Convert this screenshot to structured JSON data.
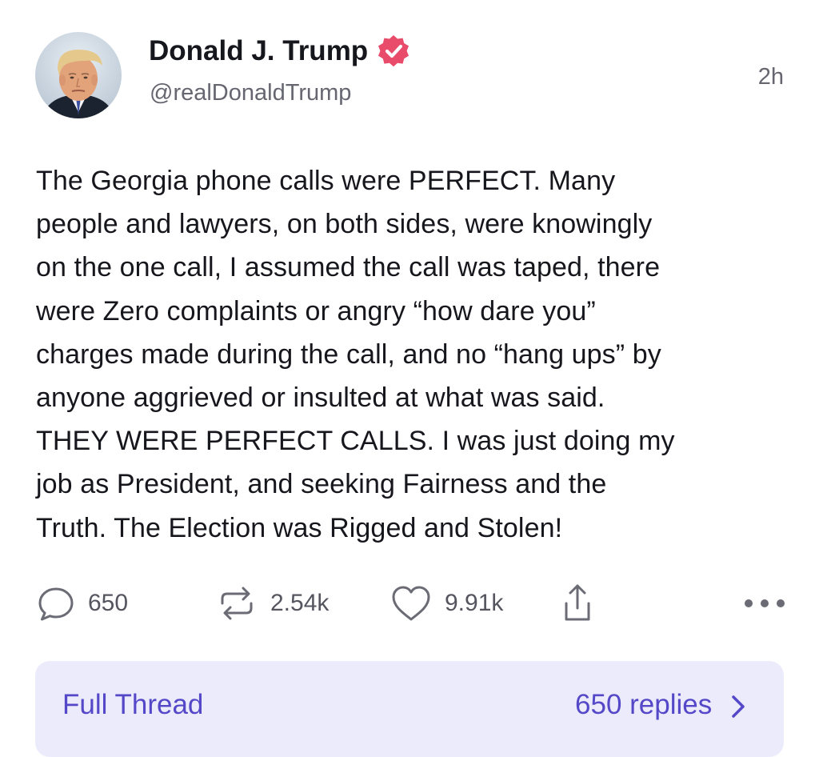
{
  "author": {
    "display_name": "Donald J. Trump",
    "handle": "@realDonaldTrump",
    "verified": true,
    "verified_badge_color": "#e94b6a",
    "avatar": "profile-photo"
  },
  "post": {
    "timestamp": "2h",
    "lines": [
      "The Georgia phone calls were PERFECT. Many",
      "people and lawyers, on both sides, were knowingly",
      "on the one call, I assumed the call was taped, there",
      "were Zero complaints or angry “how dare you”",
      "charges made during the call, and no “hang ups” by",
      "anyone aggrieved or insulted at what was said.",
      "THEY WERE PERFECT CALLS. I was just doing my",
      "job as President, and seeking Fairness and the",
      "Truth. The Election was Rigged and Stolen!"
    ]
  },
  "actions": {
    "replies": {
      "icon": "reply-icon",
      "count": "650"
    },
    "reposts": {
      "icon": "repost-icon",
      "count": "2.54k"
    },
    "likes": {
      "icon": "heart-icon",
      "count": "9.91k"
    },
    "share": {
      "icon": "share-icon"
    },
    "more": {
      "icon": "more-icon"
    }
  },
  "thread": {
    "label": "Full Thread",
    "replies_label": "650 replies",
    "accent_color": "#5448c8",
    "background_color": "#ecebfb"
  }
}
